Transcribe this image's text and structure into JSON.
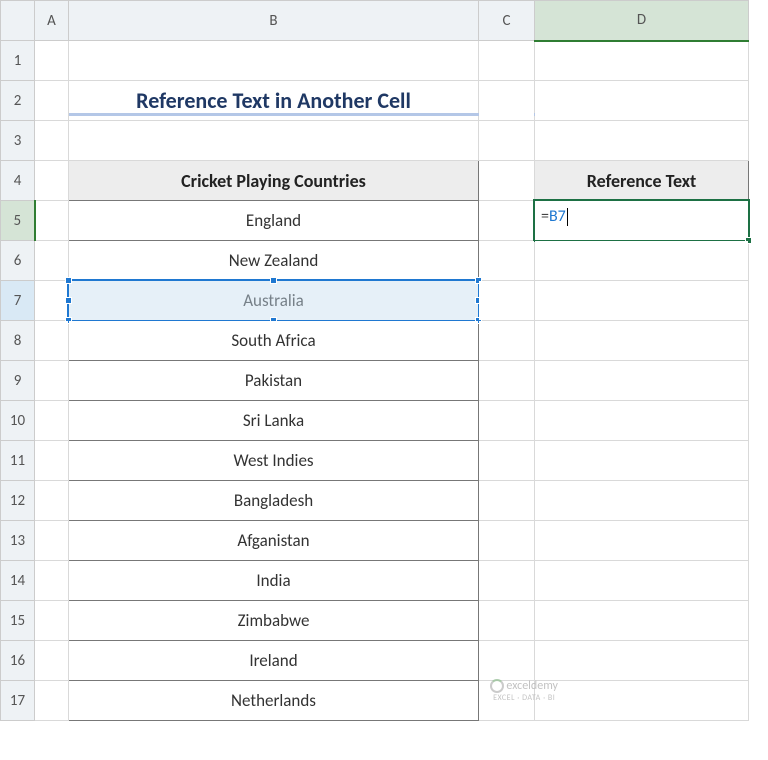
{
  "columns": [
    "A",
    "B",
    "C",
    "D"
  ],
  "rows": [
    "1",
    "2",
    "3",
    "4",
    "5",
    "6",
    "7",
    "8",
    "9",
    "10",
    "11",
    "12",
    "13",
    "14",
    "15",
    "16",
    "17"
  ],
  "title": "Reference Text in Another Cell",
  "table": {
    "header_b": "Cricket Playing Countries",
    "header_d": "Reference Text",
    "countries": [
      "England",
      "New Zealand",
      "Australia",
      "South Africa",
      "Pakistan",
      "Sri Lanka",
      "West Indies",
      "Bangladesh",
      "Afganistan",
      "India",
      "Zimbabwe",
      "Ireland",
      "Netherlands"
    ]
  },
  "formula": {
    "eq": "=",
    "ref": "B7"
  },
  "watermark": {
    "text": "exceldemy",
    "sub": "EXCEL · DATA · BI"
  }
}
